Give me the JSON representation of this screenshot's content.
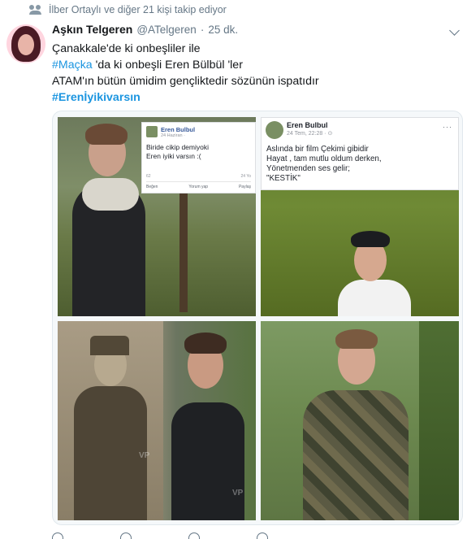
{
  "context": {
    "text": "İlber Ortaylı ve diğer 21 kişi takip ediyor"
  },
  "tweet": {
    "name": "Aşkın Telgeren",
    "handle": "@ATelgeren",
    "separator": "·",
    "time": "25 dk.",
    "lines": {
      "l1": "Çanakkale'de ki onbeşliler ile",
      "l2_tag": "#Maçka",
      "l2_rest": " 'da ki onbeşli Eren Bülbül 'ler",
      "l3": "ATAM'ın bütün ümidim gençliktedir sözünün ispatıdır",
      "l4_tag": "#Erenİyikivarsın"
    }
  },
  "fb_post_1": {
    "name": "Eren Bulbul",
    "date": "24 Haziran ·",
    "text": "Biride cikip demiyoki\nEren iyiki varsın :(",
    "likes": "62",
    "comments": "24 Yo",
    "like_label": "Beğen",
    "comment_label": "Yorum yap",
    "share_label": "Paylaş"
  },
  "fb_post_2": {
    "name": "Eren Bulbul",
    "date": "24 Tem, 22:28 · ⊙",
    "text": "Aslında bir film Çekimi gibidir\nHayat , tam mutlu oldum derken,\nYönetmenden ses gelir;\n\"KESTİK\"",
    "dots": "···"
  },
  "watermarks": {
    "w1": "VP",
    "w2": "VP"
  },
  "icons": [
    "people-icon",
    "chevron-down-icon",
    "reply-icon",
    "retweet-icon",
    "like-icon",
    "message-icon"
  ],
  "colors": {
    "link": "#1b95e0",
    "muted": "#657786",
    "text": "#14171a",
    "border": "#e1e8ed"
  }
}
